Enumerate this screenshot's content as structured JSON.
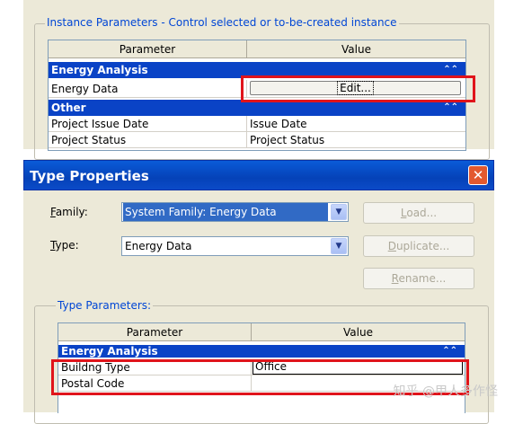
{
  "instance_panel": {
    "legend": "Instance Parameters - Control selected or to-be-created instance",
    "headers": {
      "parameter": "Parameter",
      "value": "Value"
    },
    "groups": {
      "energy_analysis": {
        "label": "Energy Analysis",
        "rows": [
          {
            "param": "Energy Data",
            "button_label": "Edit..."
          }
        ]
      },
      "other": {
        "label": "Other",
        "rows": [
          {
            "param": "Project Issue Date",
            "value": "Issue Date"
          },
          {
            "param": "Project Status",
            "value": "Project Status"
          }
        ]
      }
    }
  },
  "type_properties": {
    "title": "Type Properties",
    "close_glyph": "✕",
    "family": {
      "label_key": "F",
      "label_rest": "amily:",
      "value": "System Family: Energy Data"
    },
    "type": {
      "label_key": "T",
      "label_rest": "ype:",
      "value": "Energy Data"
    },
    "buttons": {
      "load": {
        "key": "L",
        "rest": "oad..."
      },
      "duplicate": {
        "key": "D",
        "rest": "uplicate..."
      },
      "rename": {
        "key": "R",
        "rest": "ename..."
      }
    },
    "type_params_legend": "Type Parameters:",
    "headers": {
      "parameter": "Parameter",
      "value": "Value"
    },
    "group_label": "Energy Analysis",
    "rows": [
      {
        "param": "Buildng Type",
        "value": "Office"
      },
      {
        "param": "Postal Code",
        "value": ""
      }
    ]
  },
  "watermark": "知乎 @甲人多作怪",
  "colors": {
    "group_band": "#0a43c6",
    "highlight": "#e0141b",
    "dialog_bg": "#ece9d8",
    "title_bar": "#0542b8"
  },
  "icons": {
    "collapse": "double-chevron-up-icon",
    "dropdown": "chevron-down-icon",
    "close": "close-icon"
  }
}
